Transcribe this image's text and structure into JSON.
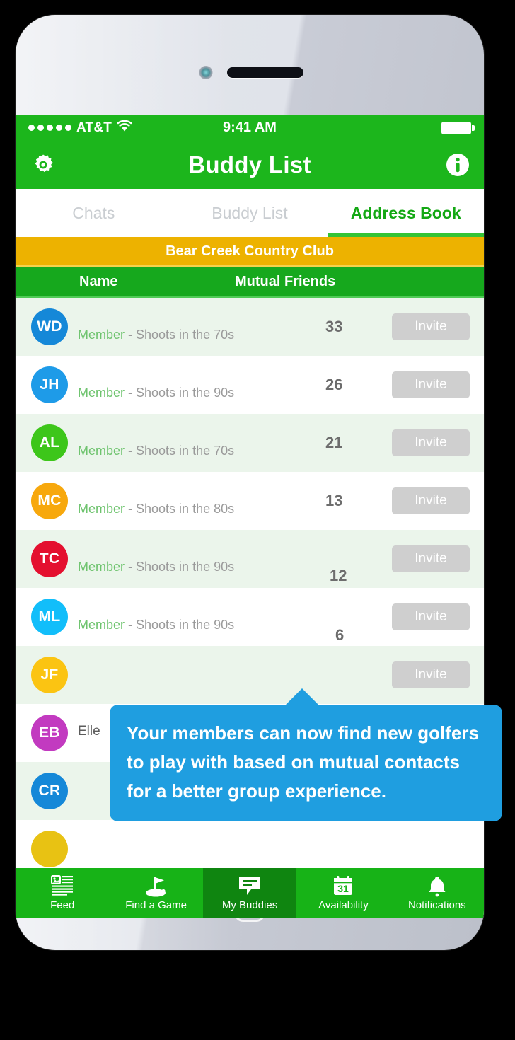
{
  "status_bar": {
    "carrier": "AT&T",
    "signal_dots": 5,
    "wifi_icon": "wifi-icon",
    "time": "9:41 AM",
    "battery_icon": "battery-full-icon"
  },
  "nav_bar": {
    "left_icon": "gear-icon",
    "title": "Buddy List",
    "right_icon": "info-icon"
  },
  "tabs": [
    {
      "label": "Chats",
      "active": false
    },
    {
      "label": "Buddy List",
      "active": false
    },
    {
      "label": "Address Book",
      "active": true
    }
  ],
  "club_banner": {
    "label": "Bear Creek Country Club"
  },
  "columns": {
    "name": "Name",
    "mutual": "Mutual Friends"
  },
  "rows": [
    {
      "initials": "WD",
      "color": "#1588d8",
      "name": "",
      "member": "Member",
      "sep": " - ",
      "shoots": "Shoots in the 70s",
      "mutual": "33",
      "invite": "Invite"
    },
    {
      "initials": "JH",
      "color": "#1e9be8",
      "name": "",
      "member": "Member",
      "sep": " - ",
      "shoots": "Shoots in the 90s",
      "mutual": "26",
      "invite": "Invite"
    },
    {
      "initials": "AL",
      "color": "#3dc61a",
      "name": "",
      "member": "Member",
      "sep": " - ",
      "shoots": "Shoots in the 70s",
      "mutual": "21",
      "invite": "Invite"
    },
    {
      "initials": "MC",
      "color": "#f7a80d",
      "name": "",
      "member": "Member",
      "sep": " - ",
      "shoots": "Shoots in the 80s",
      "mutual": "13",
      "invite": "Invite"
    },
    {
      "initials": "TC",
      "color": "#e4102f",
      "name": "",
      "member": "Member",
      "sep": " - ",
      "shoots": "Shoots in the 90s",
      "mutual": "12",
      "invite": "Invite"
    },
    {
      "initials": "ML",
      "color": "#12befa",
      "name": "",
      "member": "Member",
      "sep": " - ",
      "shoots": "Shoots in the 90s",
      "mutual": "6",
      "invite": "Invite"
    },
    {
      "initials": "JF",
      "color": "#fbc412",
      "name": "",
      "member": "",
      "sep": "",
      "shoots": "",
      "mutual": "",
      "invite": "Invite"
    },
    {
      "initials": "EB",
      "color": "#c23ac0",
      "name": "Elle",
      "member": "",
      "sep": "",
      "shoots": "",
      "mutual": "",
      "invite": ""
    },
    {
      "initials": "CR",
      "color": "#1588d8",
      "name": "",
      "member": "",
      "sep": "",
      "shoots": "",
      "mutual": "",
      "invite": ""
    },
    {
      "initials": "",
      "color": "#e8c213",
      "name": "",
      "member": "",
      "sep": "",
      "shoots": "",
      "mutual": "",
      "invite": ""
    }
  ],
  "tooltip": {
    "text": "Your members can now find new golfers to play with based on mutual contacts for a better group experience."
  },
  "tabbar": [
    {
      "label": "Feed",
      "icon": "feed-article-icon",
      "active": false
    },
    {
      "label": "Find a Game",
      "icon": "golf-flag-icon",
      "active": false
    },
    {
      "label": "My Buddies",
      "icon": "chat-bubble-icon",
      "active": true
    },
    {
      "label": "Availability",
      "icon": "calendar-31-icon",
      "active": false
    },
    {
      "label": "Notifications",
      "icon": "bell-icon",
      "active": false
    }
  ],
  "colors": {
    "brand_green": "#1cb61c",
    "banner_gold": "#edb200",
    "tooltip_blue": "#1f9ee0",
    "row_alt": "#ebf5eb"
  }
}
